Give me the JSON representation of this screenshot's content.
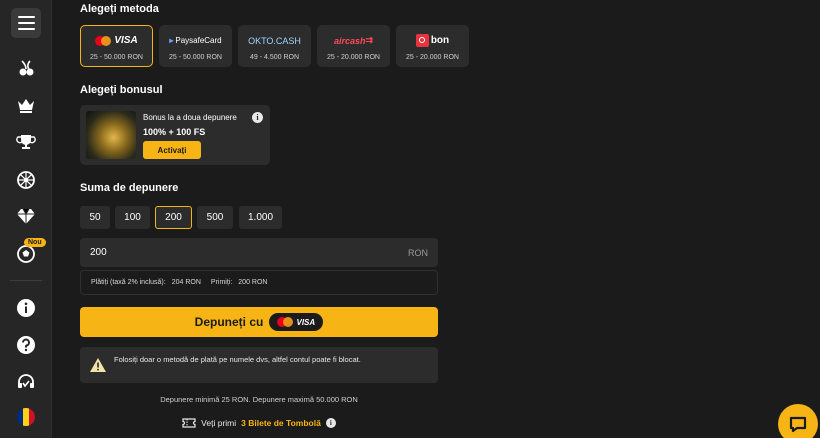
{
  "sidebar": {
    "menu_label": "Meniu",
    "badge": "Nou",
    "icons": [
      "cherry-icon",
      "crown-icon",
      "trophy-icon",
      "wheel-icon",
      "diamond-icon",
      "soccer-ball-icon",
      "info-icon",
      "help-icon",
      "support-icon",
      "romania-flag-icon"
    ]
  },
  "methods": {
    "title": "Alegeți metoda",
    "items": [
      {
        "name": "VISA",
        "range": "25 - 50.000 RON"
      },
      {
        "name": "PaysafeCard",
        "range": "25 - 50.000 RON"
      },
      {
        "name": "OKTO.CASH",
        "range": "49 - 4.500 RON"
      },
      {
        "name": "aircash",
        "range": "25 - 20.000 RON"
      },
      {
        "name": "bon",
        "range": "25 - 20.000 RON"
      }
    ]
  },
  "bonus": {
    "title": "Alegeți bonusul",
    "card_title": "Bonus la a doua depunere",
    "card_value": "100% + 100 FS",
    "activate_label": "Activați"
  },
  "amount": {
    "title": "Suma de depunere",
    "options": [
      "50",
      "100",
      "200",
      "500",
      "1.000"
    ],
    "selected": "200",
    "input_value": "200",
    "currency": "RON",
    "paid_label": "Plătiți (taxă 2% inclusă):",
    "paid_value": "204 RON",
    "received_label": "Primiți:",
    "received_value": "200 RON"
  },
  "deposit": {
    "label": "Depuneți cu",
    "method": "VISA"
  },
  "warning": {
    "text": "Folosiți doar o metodă de plată pe numele dvs, altfel contul poate fi blocat."
  },
  "limits": {
    "text": "Depunere minimă 25 RON. Depunere maximă 50.000 RON"
  },
  "tickets": {
    "prefix": "Veți primi",
    "highlight": "3 Bilete de Tombolă"
  },
  "colors": {
    "accent": "#f7b515",
    "background": "#1b1b1b",
    "card": "#2c2c2c"
  }
}
